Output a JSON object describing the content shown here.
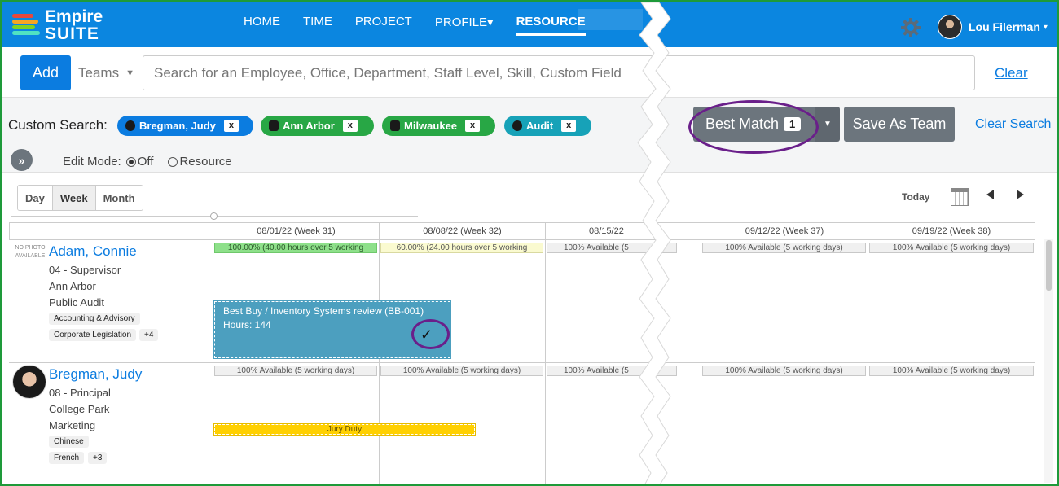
{
  "app": {
    "logo_line1": "Empire",
    "logo_line2": "SUITE"
  },
  "nav": {
    "items": [
      {
        "label": "HOME",
        "active": false
      },
      {
        "label": "TIME",
        "active": false
      },
      {
        "label": "PROJECT",
        "active": false
      },
      {
        "label": "PROFILE▾",
        "active": false
      },
      {
        "label": "RESOURCE",
        "active": true
      }
    ]
  },
  "user": {
    "name": "Lou Filerman",
    "caret": "▾"
  },
  "searchbar": {
    "add_label": "Add",
    "teams_label": "Teams",
    "search_placeholder": "Search for an Employee, Office, Department, Staff Level, Skill, Custom Field",
    "clear_label": "Clear"
  },
  "custom_search": {
    "label": "Custom Search:",
    "chips": [
      {
        "label": "Bregman, Judy",
        "remove": "x",
        "color": "blue"
      },
      {
        "label": "Ann Arbor",
        "remove": "x",
        "color": "green"
      },
      {
        "label": "Milwaukee",
        "remove": "x",
        "color": "green"
      },
      {
        "label": "Audit",
        "remove": "x",
        "color": "teal"
      }
    ],
    "best_match_label": "Best Match",
    "best_match_count": "1",
    "save_team_label": "Save As Team",
    "clear_search_label": "Clear Search",
    "expander_glyph": "»",
    "edit_mode_label": "Edit Mode:",
    "edit_mode_options": [
      "Off",
      "Resource"
    ],
    "edit_mode_selected": "Off"
  },
  "views": {
    "day": "Day",
    "week": "Week",
    "month": "Month",
    "active": "Week"
  },
  "calendar_nav": {
    "today_label": "Today"
  },
  "columns": [
    "08/01/22 (Week 31)",
    "08/08/22 (Week 32)",
    "08/15/22",
    "09/12/22 (Week 37)",
    "09/19/22 (Week 38)"
  ],
  "employees": [
    {
      "name": "Adam, Connie",
      "photo_text": "NO PHOTO AVAILABLE",
      "level": "04 - Supervisor",
      "office": "Ann Arbor",
      "department": "Public Audit",
      "skills": [
        "Accounting & Advisory",
        "Corporate Legislation"
      ],
      "more_skills": "+4",
      "availability": [
        "100.00% (40.00 hours over 5 working",
        "60.00% (24.00 hours over 5 working",
        "100% Available (5",
        "100% Available (5 working days)",
        "100% Available (5 working days)"
      ],
      "assignment": {
        "title": "Best Buy / Inventory Systems review (BB-001)",
        "hours": "Hours: 144",
        "check": "✓"
      }
    },
    {
      "name": "Bregman, Judy",
      "level": "08 - Principal",
      "office": "College Park",
      "department": "Marketing",
      "skills": [
        "Chinese",
        "French"
      ],
      "more_skills": "+3",
      "availability": [
        "100% Available (5 working days)",
        "100% Available (5 working days)",
        "100% Available (5",
        "100% Available (5 working days)",
        "100% Available (5 working days)"
      ],
      "event": "Jury Duty"
    }
  ],
  "colors": {
    "brand": "#0b86e0",
    "frame": "#1e9a3a",
    "annotation": "#6a1f8a"
  }
}
